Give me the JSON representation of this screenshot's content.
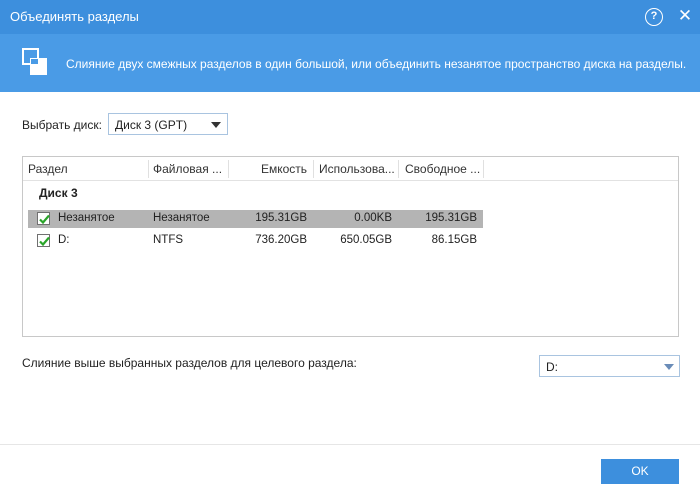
{
  "window": {
    "title": "Объединять разделы",
    "help_glyph": "?",
    "close_glyph": "✕"
  },
  "banner": {
    "icon": "merge-partitions-icon",
    "description": "Слияние двух смежных разделов в один большой, или объединить незанятое пространство диска на разделы."
  },
  "disk_select": {
    "label": "Выбрать диск:",
    "value": "Диск 3 (GPT)"
  },
  "table": {
    "columns": [
      "Раздел",
      "Файловая ...",
      "Емкость",
      "Использова...",
      "Свободное ..."
    ],
    "group_label": "Диск 3",
    "rows": [
      {
        "checked": true,
        "selected": true,
        "partition": "Незанятое",
        "filesystem": "Незанятое",
        "capacity": "195.31GB",
        "used": "0.00KB",
        "free": "195.31GB"
      },
      {
        "checked": true,
        "selected": false,
        "partition": "D:",
        "filesystem": "NTFS",
        "capacity": "736.20GB",
        "used": "650.05GB",
        "free": "86.15GB"
      }
    ]
  },
  "merge_target": {
    "label": "Слияние выше выбранных разделов для целевого раздела:",
    "value": "D:"
  },
  "footer": {
    "ok_label": "OK"
  },
  "colors": {
    "titlebar": "#3d8fdd",
    "banner": "#4a9be6",
    "selected_row": "#b4b4b4",
    "checkmark": "#2aa52a"
  }
}
